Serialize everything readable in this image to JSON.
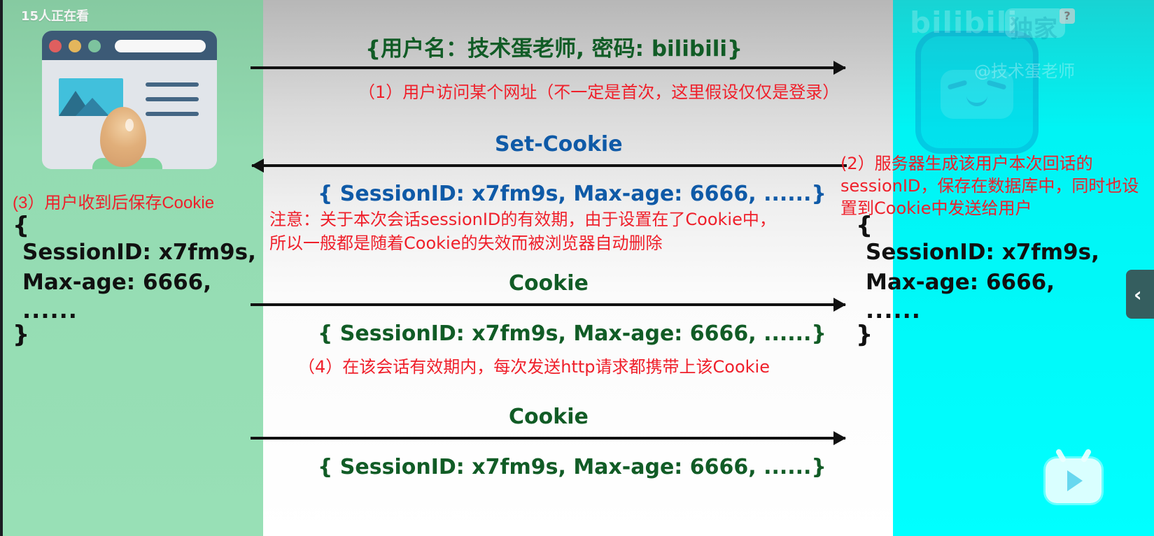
{
  "overlay": {
    "viewer_count": "15人正在看",
    "watermark_handle": "@技术蛋老师",
    "bilibili_logo_text": "bilibili",
    "exclusive_badge": "独家",
    "help_symbol": "?"
  },
  "left_panel": {
    "caption": "(3）用户收到后保存Cookie",
    "cookie": {
      "open": "{",
      "session_line": "SessionID: x7fm9s,",
      "max_age_line": "Max-age: 6666,",
      "ellipsis": "......",
      "close": "}"
    }
  },
  "center_panel": {
    "request": {
      "credentials": "{用户名：技术蛋老师, 密码: bilibili}",
      "step1": "（1）用户访问某个网址（不一定是首次，这里假设仅仅是登录）"
    },
    "set_cookie": {
      "title": "Set-Cookie",
      "value": "{ SessionID: x7fm9s, Max-age: 6666, ......}",
      "note_line1": "注意：关于本次会话sessionID的有效期，由于设置在了Cookie中，",
      "note_line2": "所以一般都是随着Cookie的失效而被浏览器自动删除"
    },
    "cookie_1": {
      "title": "Cookie",
      "value": "{ SessionID: x7fm9s, Max-age: 6666, ......}",
      "step4": "（4）在该会话有效期内，每次发送http请求都携带上该Cookie"
    },
    "cookie_2": {
      "title": "Cookie",
      "value": "{ SessionID: x7fm9s, Max-age: 6666, ......}"
    }
  },
  "right_panel": {
    "caption": "(2）服务器生成该用户本次回话的sessionID，保存在数据库中，同时也设置到Cookie中发送给用户",
    "cookie": {
      "open": "{",
      "session_line": "SessionID: x7fm9s,",
      "max_age_line": "Max-age: 6666,",
      "ellipsis": "......",
      "close": "}"
    }
  },
  "controls": {
    "collapse_symbol": "‹"
  },
  "colors": {
    "left_bg": "#98e0b6",
    "center_bg": "#ffffff",
    "right_bg": "#00ffff",
    "green_text": "#115c26",
    "blue_text": "#0f5aa7",
    "red_text": "#ef1f2a",
    "black_text": "#111111"
  },
  "icons": {
    "browser_illustration": "browser-illustration",
    "egg": "egg-icon",
    "mascot": "bilibili-mascot-icon",
    "help": "help-icon",
    "collapse": "chevron-left-icon",
    "play": "play-icon"
  }
}
